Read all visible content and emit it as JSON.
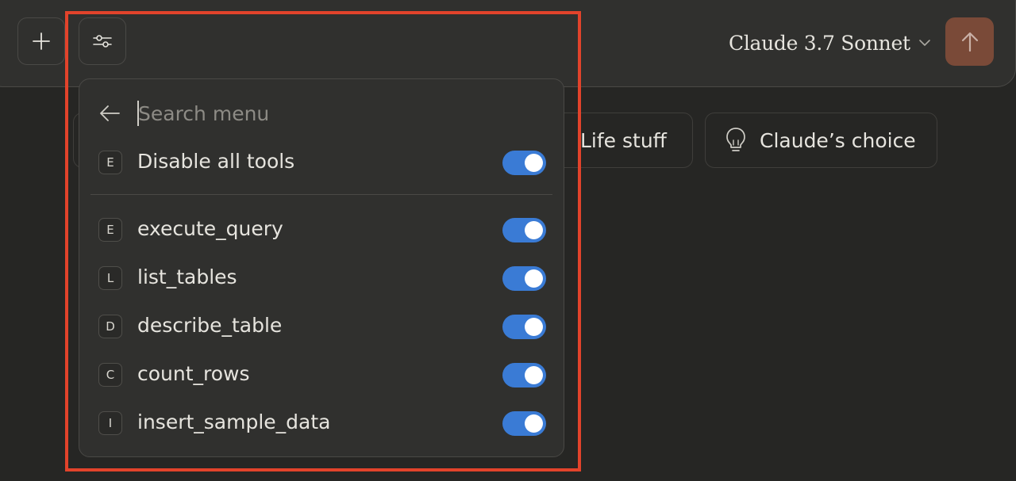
{
  "composer": {
    "model_label": "Claude 3.7 Sonnet",
    "send_color": "#7a4a38"
  },
  "chips": {
    "life": "Life stuff",
    "choice": "Claude’s choice"
  },
  "menu": {
    "search_placeholder": "Search menu",
    "disable_all": {
      "badge": "E",
      "label": "Disable all tools",
      "on": true
    },
    "tools": [
      {
        "badge": "E",
        "label": "execute_query",
        "on": true
      },
      {
        "badge": "L",
        "label": "list_tables",
        "on": true
      },
      {
        "badge": "D",
        "label": "describe_table",
        "on": true
      },
      {
        "badge": "C",
        "label": "count_rows",
        "on": true
      },
      {
        "badge": "I",
        "label": "insert_sample_data",
        "on": true
      }
    ]
  },
  "colors": {
    "toggle_on": "#3a7bd5",
    "highlight": "#e2432b"
  }
}
